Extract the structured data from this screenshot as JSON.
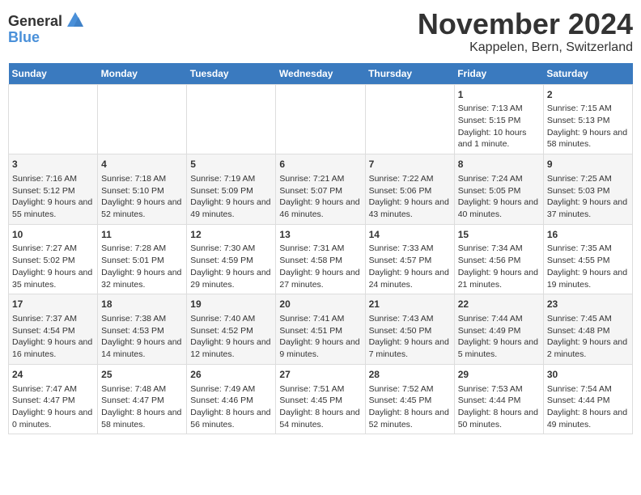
{
  "header": {
    "logo_general": "General",
    "logo_blue": "Blue",
    "month_title": "November 2024",
    "location": "Kappelen, Bern, Switzerland"
  },
  "calendar": {
    "days_of_week": [
      "Sunday",
      "Monday",
      "Tuesday",
      "Wednesday",
      "Thursday",
      "Friday",
      "Saturday"
    ],
    "weeks": [
      {
        "days": [
          {
            "num": "",
            "detail": ""
          },
          {
            "num": "",
            "detail": ""
          },
          {
            "num": "",
            "detail": ""
          },
          {
            "num": "",
            "detail": ""
          },
          {
            "num": "",
            "detail": ""
          },
          {
            "num": "1",
            "detail": "Sunrise: 7:13 AM\nSunset: 5:15 PM\nDaylight: 10 hours and 1 minute."
          },
          {
            "num": "2",
            "detail": "Sunrise: 7:15 AM\nSunset: 5:13 PM\nDaylight: 9 hours and 58 minutes."
          }
        ]
      },
      {
        "days": [
          {
            "num": "3",
            "detail": "Sunrise: 7:16 AM\nSunset: 5:12 PM\nDaylight: 9 hours and 55 minutes."
          },
          {
            "num": "4",
            "detail": "Sunrise: 7:18 AM\nSunset: 5:10 PM\nDaylight: 9 hours and 52 minutes."
          },
          {
            "num": "5",
            "detail": "Sunrise: 7:19 AM\nSunset: 5:09 PM\nDaylight: 9 hours and 49 minutes."
          },
          {
            "num": "6",
            "detail": "Sunrise: 7:21 AM\nSunset: 5:07 PM\nDaylight: 9 hours and 46 minutes."
          },
          {
            "num": "7",
            "detail": "Sunrise: 7:22 AM\nSunset: 5:06 PM\nDaylight: 9 hours and 43 minutes."
          },
          {
            "num": "8",
            "detail": "Sunrise: 7:24 AM\nSunset: 5:05 PM\nDaylight: 9 hours and 40 minutes."
          },
          {
            "num": "9",
            "detail": "Sunrise: 7:25 AM\nSunset: 5:03 PM\nDaylight: 9 hours and 37 minutes."
          }
        ]
      },
      {
        "days": [
          {
            "num": "10",
            "detail": "Sunrise: 7:27 AM\nSunset: 5:02 PM\nDaylight: 9 hours and 35 minutes."
          },
          {
            "num": "11",
            "detail": "Sunrise: 7:28 AM\nSunset: 5:01 PM\nDaylight: 9 hours and 32 minutes."
          },
          {
            "num": "12",
            "detail": "Sunrise: 7:30 AM\nSunset: 4:59 PM\nDaylight: 9 hours and 29 minutes."
          },
          {
            "num": "13",
            "detail": "Sunrise: 7:31 AM\nSunset: 4:58 PM\nDaylight: 9 hours and 27 minutes."
          },
          {
            "num": "14",
            "detail": "Sunrise: 7:33 AM\nSunset: 4:57 PM\nDaylight: 9 hours and 24 minutes."
          },
          {
            "num": "15",
            "detail": "Sunrise: 7:34 AM\nSunset: 4:56 PM\nDaylight: 9 hours and 21 minutes."
          },
          {
            "num": "16",
            "detail": "Sunrise: 7:35 AM\nSunset: 4:55 PM\nDaylight: 9 hours and 19 minutes."
          }
        ]
      },
      {
        "days": [
          {
            "num": "17",
            "detail": "Sunrise: 7:37 AM\nSunset: 4:54 PM\nDaylight: 9 hours and 16 minutes."
          },
          {
            "num": "18",
            "detail": "Sunrise: 7:38 AM\nSunset: 4:53 PM\nDaylight: 9 hours and 14 minutes."
          },
          {
            "num": "19",
            "detail": "Sunrise: 7:40 AM\nSunset: 4:52 PM\nDaylight: 9 hours and 12 minutes."
          },
          {
            "num": "20",
            "detail": "Sunrise: 7:41 AM\nSunset: 4:51 PM\nDaylight: 9 hours and 9 minutes."
          },
          {
            "num": "21",
            "detail": "Sunrise: 7:43 AM\nSunset: 4:50 PM\nDaylight: 9 hours and 7 minutes."
          },
          {
            "num": "22",
            "detail": "Sunrise: 7:44 AM\nSunset: 4:49 PM\nDaylight: 9 hours and 5 minutes."
          },
          {
            "num": "23",
            "detail": "Sunrise: 7:45 AM\nSunset: 4:48 PM\nDaylight: 9 hours and 2 minutes."
          }
        ]
      },
      {
        "days": [
          {
            "num": "24",
            "detail": "Sunrise: 7:47 AM\nSunset: 4:47 PM\nDaylight: 9 hours and 0 minutes."
          },
          {
            "num": "25",
            "detail": "Sunrise: 7:48 AM\nSunset: 4:47 PM\nDaylight: 8 hours and 58 minutes."
          },
          {
            "num": "26",
            "detail": "Sunrise: 7:49 AM\nSunset: 4:46 PM\nDaylight: 8 hours and 56 minutes."
          },
          {
            "num": "27",
            "detail": "Sunrise: 7:51 AM\nSunset: 4:45 PM\nDaylight: 8 hours and 54 minutes."
          },
          {
            "num": "28",
            "detail": "Sunrise: 7:52 AM\nSunset: 4:45 PM\nDaylight: 8 hours and 52 minutes."
          },
          {
            "num": "29",
            "detail": "Sunrise: 7:53 AM\nSunset: 4:44 PM\nDaylight: 8 hours and 50 minutes."
          },
          {
            "num": "30",
            "detail": "Sunrise: 7:54 AM\nSunset: 4:44 PM\nDaylight: 8 hours and 49 minutes."
          }
        ]
      }
    ]
  }
}
